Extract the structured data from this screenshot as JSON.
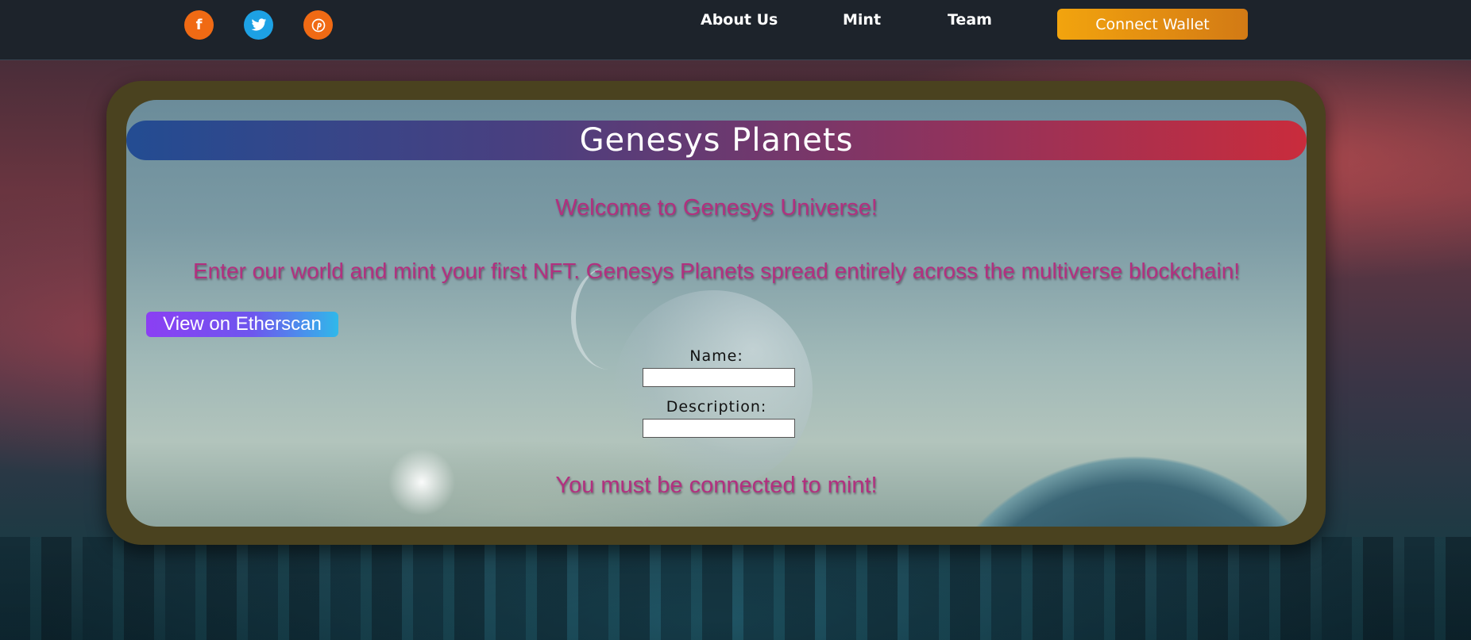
{
  "nav": {
    "social": [
      {
        "name": "facebook",
        "glyph": "f",
        "color": "#f06a14"
      },
      {
        "name": "twitter",
        "glyph": "🐦",
        "color": "#1da1e4"
      },
      {
        "name": "pinterest",
        "glyph": "℗",
        "color": "#f06a14"
      }
    ],
    "links": [
      "About Us",
      "Mint",
      "Team"
    ],
    "connect_label": "Connect Wallet"
  },
  "hero": {
    "title": "Genesys Planets",
    "welcome": "Welcome to Genesys Universe!",
    "intro": "Enter our world and mint your first NFT. Genesys Planets spread entirely across the multiverse blockchain!",
    "etherscan_label": "View on Etherscan"
  },
  "form": {
    "name_label": "Name:",
    "name_value": "",
    "description_label": "Description:",
    "description_value": ""
  },
  "status": "You must be connected to mint!",
  "colors": {
    "navbar": "#1d232b",
    "accent_orange": "#f2a40e",
    "text_magenta": "#b2307f",
    "frame": "#4a421f"
  }
}
